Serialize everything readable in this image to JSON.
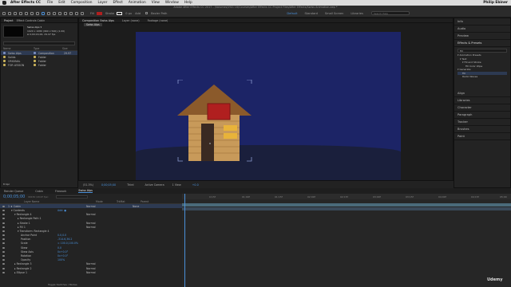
{
  "menubar": {
    "app_name": "After Effects CC",
    "items": [
      "File",
      "Edit",
      "Composition",
      "Layer",
      "Effect",
      "Animation",
      "View",
      "Window",
      "Help"
    ],
    "user": "Philip Ebiner"
  },
  "titlebar": {
    "text": "Adobe After Effects CC 2017 - /Volumes/VSG 16/Courses/After Effects CC Project Files/After Effects/Swiss Animation.aep *"
  },
  "toolbar": {
    "fill_label": "Fill",
    "stroke_label": "Stroke",
    "stroke_width": "0 px",
    "add_label": "Add",
    "bezier_label": "Bezier Path",
    "workspaces": [
      "Default",
      "Standard",
      "Small Screen",
      "Libraries"
    ],
    "active_workspace": "Default",
    "search_placeholder": "Search Help"
  },
  "project": {
    "tabs": [
      "Project",
      "Effect Controls Cabin"
    ],
    "comp_name": "Swiss Alps ▾",
    "comp_info_1": "1920 x 1080 (960 x 540) (1.00)",
    "comp_info_2": "Δ 0;00;16;00, 29.97 fps",
    "search_placeholder": "",
    "col_name": "Name",
    "col_type": "Type",
    "col_size": "Size",
    "rows": [
      {
        "name": "Swiss Alps",
        "type": "Composition",
        "size": "29.97",
        "color": "#7a8cc0"
      },
      {
        "name": "Solids",
        "type": "Folder",
        "size": "",
        "color": "#c9b25a"
      },
      {
        "name": "ORIGINAL",
        "type": "Folder",
        "size": "",
        "color": "#c9b25a"
      },
      {
        "name": "FOR LESSON",
        "type": "Folder",
        "size": "",
        "color": "#c9b25a"
      }
    ],
    "bpc": "8 bpc"
  },
  "viewer": {
    "tabs": [
      "Composition Swiss Alps",
      "Layer (none)",
      "Footage (none)"
    ],
    "breadcrumb": "Swiss Alps",
    "zoom": "(51.3%)",
    "timecode": "0;00;05;00",
    "resolution": "Third",
    "camera": "Active Camera",
    "views": "1 View",
    "exposure": "+0.0"
  },
  "right_panels": {
    "items": [
      "Info",
      "Audio",
      "Preview",
      "Effects & Presets",
      "Align",
      "Libraries",
      "Character",
      "Paragraph",
      "Tracker",
      "Brushes",
      "Paint"
    ],
    "effects_search": "fill",
    "effects_tree": [
      "▾ Animation Presets",
      "▾ Text",
      "▾ Fill and Stroke",
      "Fill Color Wipe",
      "▾ Generate",
      "Fill",
      "Radio Waves"
    ]
  },
  "timeline": {
    "tabs": [
      "Render Queue",
      "Cabin",
      "Firework",
      "Swiss Alps"
    ],
    "active_tab": "Swiss Alps",
    "timecode": "0;00;05;00",
    "fps_label": "00150 (29.97 fps)",
    "col_layer": "Layer Name",
    "col_mode": "Mode",
    "col_trkmat": "TrkMat",
    "col_parent": "Parent",
    "ruler": [
      "0:15f",
      "01:00f",
      "01:15f",
      "02:00f",
      "02:15f",
      "03:00f",
      "03:15f",
      "04:00f",
      "04:15f",
      "05:00"
    ],
    "layers": [
      {
        "indent": 0,
        "label": "1  ★ Cabin",
        "mode": "Normal",
        "parent": "None",
        "value": "",
        "color": "#4a90d9"
      },
      {
        "indent": 1,
        "label": "▾ Contents",
        "mode": "",
        "parent": "",
        "value": "Add: ●",
        "color": ""
      },
      {
        "indent": 2,
        "label": "▾ Rectangle 4",
        "mode": "Normal",
        "parent": "",
        "value": "",
        "color": ""
      },
      {
        "indent": 3,
        "label": "▸ Rectangle Path 1",
        "mode": "",
        "parent": "",
        "value": "",
        "color": ""
      },
      {
        "indent": 3,
        "label": "▸ Stroke 1",
        "mode": "Normal",
        "parent": "",
        "value": "",
        "color": ""
      },
      {
        "indent": 3,
        "label": "▸ Fill 1",
        "mode": "Normal",
        "parent": "",
        "value": "",
        "color": ""
      },
      {
        "indent": 3,
        "label": "▾ Transform: Rectangle 4",
        "mode": "",
        "parent": "",
        "value": "",
        "color": ""
      },
      {
        "indent": 4,
        "label": "Anchor Point",
        "mode": "",
        "parent": "",
        "value": "0.0,0.0",
        "color": ""
      },
      {
        "indent": 4,
        "label": "Position",
        "mode": "",
        "parent": "",
        "value": "-314.6,36.2",
        "color": ""
      },
      {
        "indent": 4,
        "label": "Scale",
        "mode": "",
        "parent": "",
        "value": "∞ 100.0,100.0%",
        "color": ""
      },
      {
        "indent": 4,
        "label": "Skew",
        "mode": "",
        "parent": "",
        "value": "0.0",
        "color": ""
      },
      {
        "indent": 4,
        "label": "Skew Axis",
        "mode": "",
        "parent": "",
        "value": "0x+0.0°",
        "color": ""
      },
      {
        "indent": 4,
        "label": "Rotation",
        "mode": "",
        "parent": "",
        "value": "0x+0.0°",
        "color": ""
      },
      {
        "indent": 4,
        "label": "Opacity",
        "mode": "",
        "parent": "",
        "value": "100%",
        "color": ""
      },
      {
        "indent": 2,
        "label": "▸ Rectangle 3",
        "mode": "Normal",
        "parent": "",
        "value": "",
        "color": ""
      },
      {
        "indent": 2,
        "label": "▸ Rectangle 2",
        "mode": "Normal",
        "parent": "",
        "value": "",
        "color": ""
      },
      {
        "indent": 2,
        "label": "▸ Ellipse 1",
        "mode": "Normal",
        "parent": "",
        "value": "",
        "color": ""
      }
    ],
    "toggle_label": "Toggle Switches / Modes"
  },
  "watermark": "Udemy",
  "colors": {
    "accent": "#4a90d9",
    "comp_bg": "#1c2466",
    "roof": "#8b5a2b",
    "wall": "#c89a5a",
    "door": "#3a2a22",
    "chimney": "#b01f1f",
    "window": "#e8b33a"
  }
}
